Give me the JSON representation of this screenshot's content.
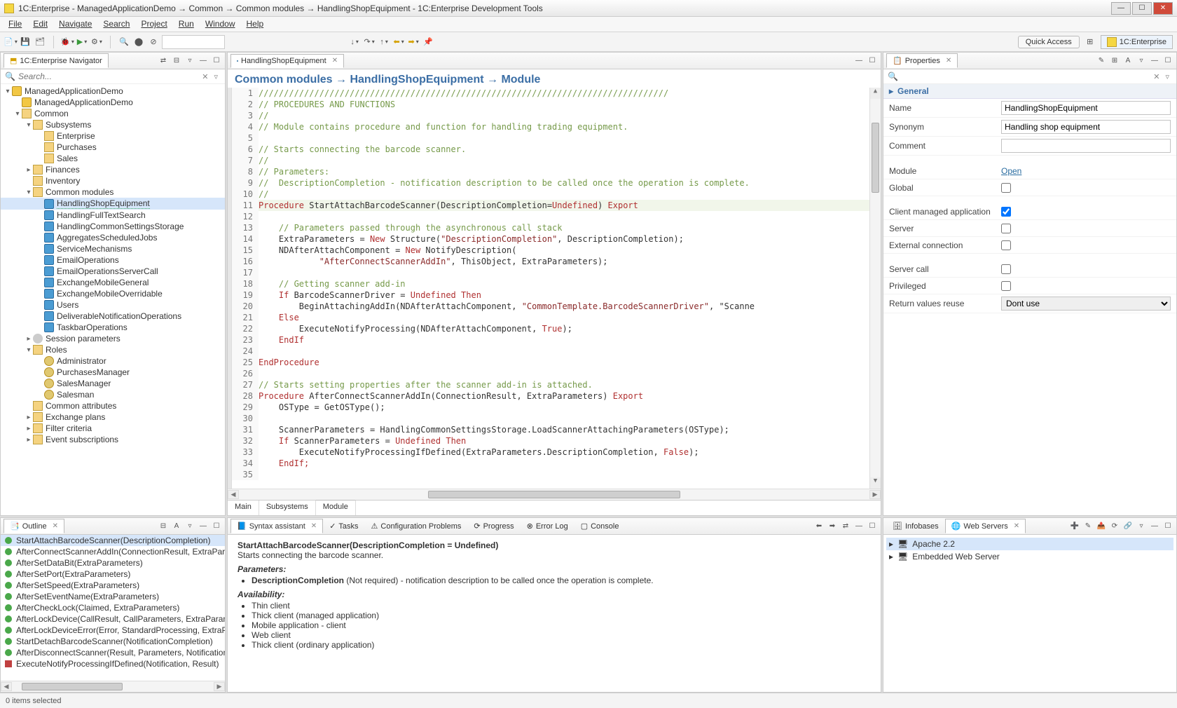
{
  "title": "1C:Enterprise - ManagedApplicationDemo → Common → Common modules → HandlingShopEquipment - 1C:Enterprise Development Tools",
  "menu": [
    "File",
    "Edit",
    "Navigate",
    "Search",
    "Project",
    "Run",
    "Window",
    "Help"
  ],
  "toolbar_right": {
    "quick_access": "Quick Access",
    "perspective": "1C:Enterprise"
  },
  "navigator": {
    "title": "1C:Enterprise Navigator",
    "search_placeholder": "Search...",
    "tree": [
      {
        "lvl": 0,
        "exp": "▾",
        "ic": "ic-cyl",
        "label": "ManagedApplicationDemo"
      },
      {
        "lvl": 1,
        "exp": "",
        "ic": "ic-cyl",
        "label": "ManagedApplicationDemo"
      },
      {
        "lvl": 1,
        "exp": "▾",
        "ic": "ic-fold",
        "label": "Common"
      },
      {
        "lvl": 2,
        "exp": "▾",
        "ic": "ic-fold",
        "label": "Subsystems"
      },
      {
        "lvl": 3,
        "exp": "",
        "ic": "ic-fold",
        "label": "Enterprise"
      },
      {
        "lvl": 3,
        "exp": "",
        "ic": "ic-fold",
        "label": "Purchases"
      },
      {
        "lvl": 3,
        "exp": "",
        "ic": "ic-fold",
        "label": "Sales"
      },
      {
        "lvl": 2,
        "exp": "▸",
        "ic": "ic-fold",
        "label": "Finances"
      },
      {
        "lvl": 2,
        "exp": "",
        "ic": "ic-fold",
        "label": "Inventory"
      },
      {
        "lvl": 2,
        "exp": "▾",
        "ic": "ic-fold",
        "label": "Common modules"
      },
      {
        "lvl": 3,
        "exp": "",
        "ic": "ic-mod",
        "label": "HandlingShopEquipment",
        "selected": true
      },
      {
        "lvl": 3,
        "exp": "",
        "ic": "ic-mod",
        "label": "HandlingFullTextSearch"
      },
      {
        "lvl": 3,
        "exp": "",
        "ic": "ic-mod",
        "label": "HandlingCommonSettingsStorage"
      },
      {
        "lvl": 3,
        "exp": "",
        "ic": "ic-mod",
        "label": "AggregatesScheduledJobs"
      },
      {
        "lvl": 3,
        "exp": "",
        "ic": "ic-mod",
        "label": "ServiceMechanisms"
      },
      {
        "lvl": 3,
        "exp": "",
        "ic": "ic-mod",
        "label": "EmailOperations"
      },
      {
        "lvl": 3,
        "exp": "",
        "ic": "ic-mod",
        "label": "EmailOperationsServerCall"
      },
      {
        "lvl": 3,
        "exp": "",
        "ic": "ic-mod",
        "label": "ExchangeMobileGeneral"
      },
      {
        "lvl": 3,
        "exp": "",
        "ic": "ic-mod",
        "label": "ExchangeMobileOverridable"
      },
      {
        "lvl": 3,
        "exp": "",
        "ic": "ic-mod",
        "label": "Users"
      },
      {
        "lvl": 3,
        "exp": "",
        "ic": "ic-mod",
        "label": "DeliverableNotificationOperations"
      },
      {
        "lvl": 3,
        "exp": "",
        "ic": "ic-mod",
        "label": "TaskbarOperations"
      },
      {
        "lvl": 2,
        "exp": "▸",
        "ic": "ic-gear",
        "label": "Session parameters"
      },
      {
        "lvl": 2,
        "exp": "▾",
        "ic": "ic-fold",
        "label": "Roles"
      },
      {
        "lvl": 3,
        "exp": "",
        "ic": "ic-role",
        "label": "Administrator"
      },
      {
        "lvl": 3,
        "exp": "",
        "ic": "ic-role",
        "label": "PurchasesManager"
      },
      {
        "lvl": 3,
        "exp": "",
        "ic": "ic-role",
        "label": "SalesManager"
      },
      {
        "lvl": 3,
        "exp": "",
        "ic": "ic-role",
        "label": "Salesman"
      },
      {
        "lvl": 2,
        "exp": "",
        "ic": "ic-fold",
        "label": "Common attributes"
      },
      {
        "lvl": 2,
        "exp": "▸",
        "ic": "ic-fold",
        "label": "Exchange plans"
      },
      {
        "lvl": 2,
        "exp": "▸",
        "ic": "ic-fold",
        "label": "Filter criteria"
      },
      {
        "lvl": 2,
        "exp": "▸",
        "ic": "ic-fold",
        "label": "Event subscriptions"
      }
    ]
  },
  "editor": {
    "tab": "HandlingShopEquipment",
    "breadcrumb": "Common modules → HandlingShopEquipment → Module",
    "bottom_tabs": [
      "Main",
      "Subsystems",
      "Module"
    ],
    "code": [
      {
        "n": 1,
        "t": "comm",
        "txt": "/////////////////////////////////////////////////////////////////////////////////"
      },
      {
        "n": 2,
        "t": "comm",
        "txt": "// PROCEDURES AND FUNCTIONS"
      },
      {
        "n": 3,
        "t": "comm",
        "txt": "//"
      },
      {
        "n": 4,
        "t": "comm",
        "txt": "// Module contains procedure and function for handling trading equipment."
      },
      {
        "n": 5,
        "t": "",
        "txt": ""
      },
      {
        "n": 6,
        "t": "comm",
        "txt": "// Starts connecting the barcode scanner."
      },
      {
        "n": 7,
        "t": "comm",
        "txt": "//"
      },
      {
        "n": 8,
        "t": "comm",
        "txt": "// Parameters:"
      },
      {
        "n": 9,
        "t": "comm",
        "txt": "//  DescriptionCompletion - notification description to be called once the operation is complete."
      },
      {
        "n": 10,
        "t": "comm",
        "txt": "//"
      },
      {
        "n": 11,
        "t": "proc",
        "txt": "Procedure StartAttachBarcodeScanner(DescriptionCompletion=Undefined) Export",
        "current": true
      },
      {
        "n": 12,
        "t": "",
        "txt": ""
      },
      {
        "n": 13,
        "t": "comm",
        "txt": "    // Parameters passed through the asynchronous call stack"
      },
      {
        "n": 14,
        "t": "code",
        "txt": "    ExtraParameters = New Structure(\"DescriptionCompletion\", DescriptionCompletion);"
      },
      {
        "n": 15,
        "t": "code",
        "txt": "    NDAfterAttachComponent = New NotifyDescription("
      },
      {
        "n": 16,
        "t": "code",
        "txt": "            \"AfterConnectScannerAddIn\", ThisObject, ExtraParameters);"
      },
      {
        "n": 17,
        "t": "",
        "txt": ""
      },
      {
        "n": 18,
        "t": "comm",
        "txt": "    // Getting scanner add-in"
      },
      {
        "n": 19,
        "t": "code",
        "txt": "    If BarcodeScannerDriver = Undefined Then"
      },
      {
        "n": 20,
        "t": "code",
        "txt": "        BeginAttachingAddIn(NDAfterAttachComponent, \"CommonTemplate.BarcodeScannerDriver\", \"Scanne"
      },
      {
        "n": 21,
        "t": "kw",
        "txt": "    Else"
      },
      {
        "n": 22,
        "t": "code",
        "txt": "        ExecuteNotifyProcessing(NDAfterAttachComponent, True);"
      },
      {
        "n": 23,
        "t": "kw",
        "txt": "    EndIf"
      },
      {
        "n": 24,
        "t": "",
        "txt": ""
      },
      {
        "n": 25,
        "t": "kw",
        "txt": "EndProcedure"
      },
      {
        "n": 26,
        "t": "",
        "txt": ""
      },
      {
        "n": 27,
        "t": "comm",
        "txt": "// Starts setting properties after the scanner add-in is attached."
      },
      {
        "n": 28,
        "t": "proc",
        "txt": "Procedure AfterConnectScannerAddIn(ConnectionResult, ExtraParameters) Export"
      },
      {
        "n": 29,
        "t": "code",
        "txt": "    OSType = GetOSType();"
      },
      {
        "n": 30,
        "t": "",
        "txt": ""
      },
      {
        "n": 31,
        "t": "code",
        "txt": "    ScannerParameters = HandlingCommonSettingsStorage.LoadScannerAttachingParameters(OSType);"
      },
      {
        "n": 32,
        "t": "code",
        "txt": "    If ScannerParameters = Undefined Then"
      },
      {
        "n": 33,
        "t": "code",
        "txt": "        ExecuteNotifyProcessingIfDefined(ExtraParameters.DescriptionCompletion, False);"
      },
      {
        "n": 34,
        "t": "kw",
        "txt": "    EndIf;"
      },
      {
        "n": 35,
        "t": "",
        "txt": ""
      }
    ]
  },
  "properties": {
    "title": "Properties",
    "section": "General",
    "name_lbl": "Name",
    "name": "HandlingShopEquipment",
    "syn_lbl": "Synonym",
    "syn": "Handling shop equipment",
    "comment_lbl": "Comment",
    "comment": "",
    "module_lbl": "Module",
    "module_link": "Open",
    "global_lbl": "Global",
    "cma_lbl": "Client managed application",
    "cma": true,
    "server_lbl": "Server",
    "ext_lbl": "External connection",
    "scall_lbl": "Server call",
    "priv_lbl": "Privileged",
    "rvr_lbl": "Return values reuse",
    "rvr": "Dont use"
  },
  "outline": {
    "title": "Outline",
    "items": [
      {
        "k": "g",
        "label": "StartAttachBarcodeScanner(DescriptionCompletion)",
        "selected": true
      },
      {
        "k": "g",
        "label": "AfterConnectScannerAddIn(ConnectionResult, ExtraParameters)"
      },
      {
        "k": "g",
        "label": "AfterSetDataBit(ExtraParameters)"
      },
      {
        "k": "g",
        "label": "AfterSetPort(ExtraParameters)"
      },
      {
        "k": "g",
        "label": "AfterSetSpeed(ExtraParameters)"
      },
      {
        "k": "g",
        "label": "AfterSetEventName(ExtraParameters)"
      },
      {
        "k": "g",
        "label": "AfterCheckLock(Claimed, ExtraParameters)"
      },
      {
        "k": "g",
        "label": "AfterLockDevice(CallResult, CallParameters, ExtraParameters)"
      },
      {
        "k": "g",
        "label": "AfterLockDeviceError(Error, StandardProcessing, ExtraParame"
      },
      {
        "k": "g",
        "label": "StartDetachBarcodeScanner(NotificationCompletion)"
      },
      {
        "k": "g",
        "label": "AfterDisconnectScanner(Result, Parameters, NotificationCom"
      },
      {
        "k": "r",
        "label": "ExecuteNotifyProcessingIfDefined(Notification, Result)"
      }
    ]
  },
  "syntax_assist": {
    "tabs": [
      "Syntax assistant",
      "Tasks",
      "Configuration Problems",
      "Progress",
      "Error Log",
      "Console"
    ],
    "sig": "StartAttachBarcodeScanner(DescriptionCompletion = Undefined)",
    "desc": "Starts connecting the barcode scanner.",
    "params_h": "Parameters:",
    "param_name": "DescriptionCompletion",
    "param_req": "(Not required)",
    "param_desc": " - notification description to be called once the operation is complete.",
    "avail_h": "Availability:",
    "avail": [
      "Thin client",
      "Thick client (managed application)",
      "Mobile application - client",
      "Web client",
      "Thick client (ordinary application)"
    ]
  },
  "infobase": {
    "tabs": [
      "Infobases",
      "Web Servers"
    ],
    "items": [
      {
        "label": "Apache 2.2",
        "selected": true
      },
      {
        "label": "Embedded Web Server"
      }
    ]
  },
  "status": "0 items selected"
}
